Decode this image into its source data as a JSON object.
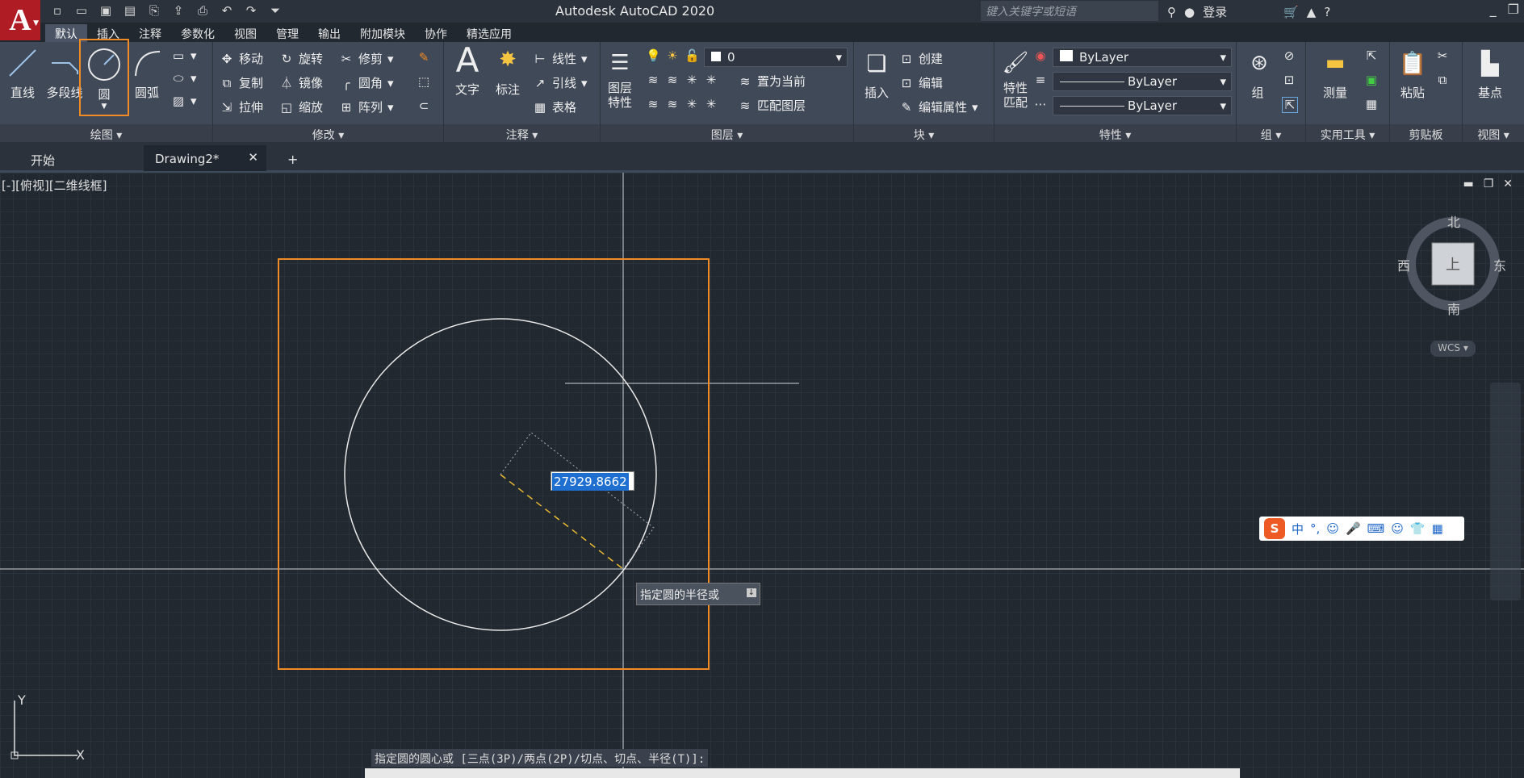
{
  "app": {
    "title": "Autodesk AutoCAD 2020",
    "logo": "A",
    "search_placeholder": "键入关键字或短语",
    "login": "登录"
  },
  "menu_tabs": [
    "默认",
    "插入",
    "注释",
    "参数化",
    "视图",
    "管理",
    "输出",
    "附加模块",
    "协作",
    "精选应用"
  ],
  "ribbon": {
    "draw": {
      "label": "绘图",
      "tools": [
        "直线",
        "多段线",
        "圆",
        "圆弧"
      ]
    },
    "modify": {
      "label": "修改",
      "tools": [
        "移动",
        "旋转",
        "修剪",
        "复制",
        "镜像",
        "圆角",
        "拉伸",
        "缩放",
        "阵列"
      ]
    },
    "annotate": {
      "label": "注释",
      "tools": [
        "文字",
        "标注",
        "线性",
        "引线",
        "表格"
      ]
    },
    "layers": {
      "label": "图层",
      "props": "图层\n特性",
      "current": "0",
      "set_current": "置为当前",
      "match": "匹配图层"
    },
    "block": {
      "label": "块",
      "insert": "插入",
      "create": "创建",
      "edit": "编辑",
      "edit_attr": "编辑属性"
    },
    "properties": {
      "label": "特性",
      "match": "特性\n匹配",
      "color": "ByLayer",
      "linetype": "ByLayer",
      "lineweight": "ByLayer"
    },
    "groups": {
      "label": "组",
      "group": "组"
    },
    "utilities": {
      "label": "实用工具",
      "measure": "测量"
    },
    "clipboard": {
      "label": "剪贴板",
      "paste": "粘贴"
    },
    "view": {
      "label": "视图",
      "base": "基点"
    }
  },
  "doc_tabs": [
    {
      "label": "开始"
    },
    {
      "label": "Drawing2*"
    }
  ],
  "viewport": {
    "label": "[-][俯视][二维线框]",
    "compass": {
      "n": "北",
      "s": "南",
      "e": "东",
      "w": "西",
      "top": "上"
    },
    "wcs": "WCS"
  },
  "dynamic_input": {
    "value": "27929.8662",
    "prompt": "指定圆的半径或"
  },
  "command_line": "指定圆的圆心或 [三点(3P)/两点(2P)/切点、切点、半径(T)]:",
  "ime": {
    "mode": "中"
  },
  "ucs": {
    "x": "X",
    "y": "Y"
  },
  "colors": {
    "accent": "#f08b25",
    "background": "#212830",
    "ribbon": "#404957"
  }
}
